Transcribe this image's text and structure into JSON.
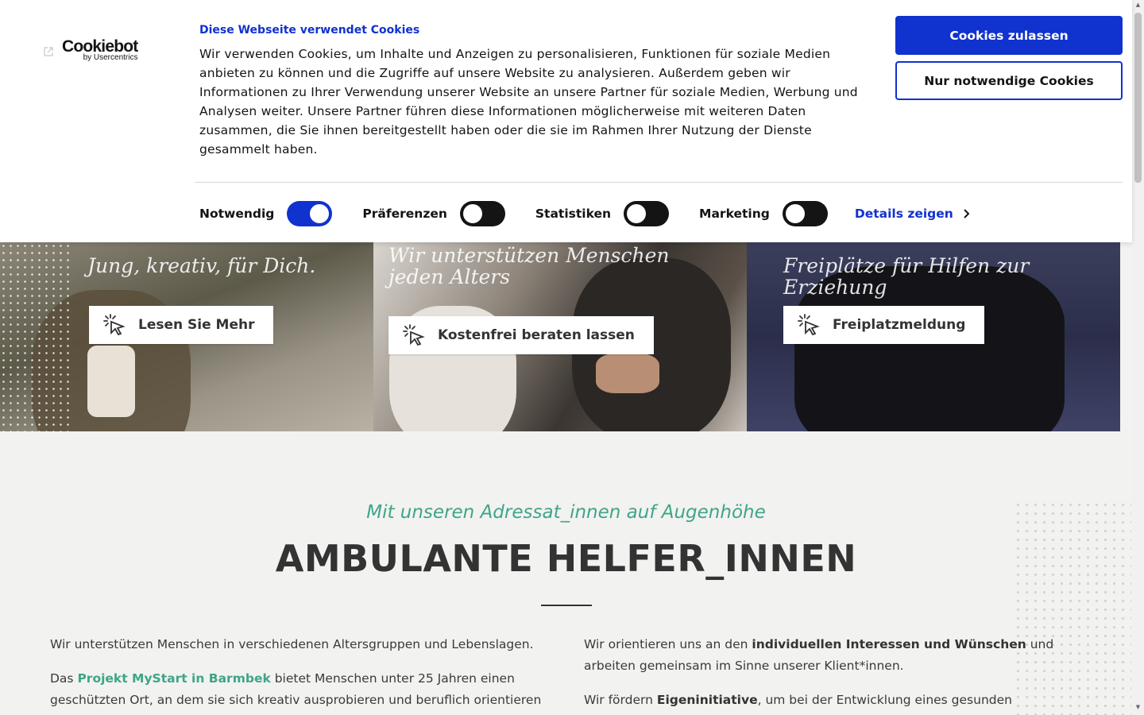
{
  "cookie_banner": {
    "logo_brand": "Cookiebot",
    "logo_sub": "by Usercentrics",
    "title": "Diese Webseite verwendet Cookies",
    "body": "Wir verwenden Cookies, um Inhalte und Anzeigen zu personalisieren, Funktionen für soziale Medien anbieten zu können und die Zugriffe auf unsere Website zu analysieren. Außerdem geben wir Informationen zu Ihrer Verwendung unserer Website an unsere Partner für soziale Medien, Werbung und Analysen weiter. Unsere Partner führen diese Informationen möglicherweise mit weiteren Daten zusammen, die Sie ihnen bereitgestellt haben oder die sie im Rahmen Ihrer Nutzung der Dienste gesammelt haben.",
    "allow_button": "Cookies zulassen",
    "necessary_button": "Nur notwendige Cookies",
    "toggles": [
      {
        "label": "Notwendig",
        "on": true
      },
      {
        "label": "Präferenzen",
        "on": false
      },
      {
        "label": "Statistiken",
        "on": false
      },
      {
        "label": "Marketing",
        "on": false
      }
    ],
    "details_link": "Details zeigen",
    "accent_color": "#1032cf"
  },
  "hero": {
    "panels": [
      {
        "tagline": "Jung, kreativ, für Dich.",
        "cta": "Lesen Sie Mehr"
      },
      {
        "tagline": "Wir unterstützen Menschen jeden Alters",
        "cta": "Kostenfrei beraten lassen"
      },
      {
        "tagline": "Freiplätze für Hilfen zur Erziehung",
        "cta": "Freiplatzmeldung"
      }
    ],
    "cta_icon": "pointer-click-icon"
  },
  "section": {
    "subtitle": "Mit unseren Adressat_innen auf Augenhöhe",
    "headline": "AMBULANTE HELFER_INNEN",
    "left": {
      "p1": "Wir unterstützen Menschen in verschiedenen Altersgruppen und Lebenslagen.",
      "p2_prefix": "Das ",
      "p2_link": "Projekt MyStart in Barmbek",
      "p2_suffix": " bietet Menschen unter 25 Jahren einen geschützten Ort, an dem sie sich kreativ ausprobieren und beruflich orientieren"
    },
    "right": {
      "p1_prefix": "Wir orientieren uns an den ",
      "p1_bold": "individuellen Interessen und Wünschen",
      "p1_suffix": " und arbeiten gemeinsam im Sinne unserer Klient*innen.",
      "p2_prefix": "Wir fördern ",
      "p2_bold": "Eigeninitiative",
      "p2_suffix": ", um bei der Entwicklung eines gesunden"
    },
    "accent_color": "#3fa587"
  }
}
